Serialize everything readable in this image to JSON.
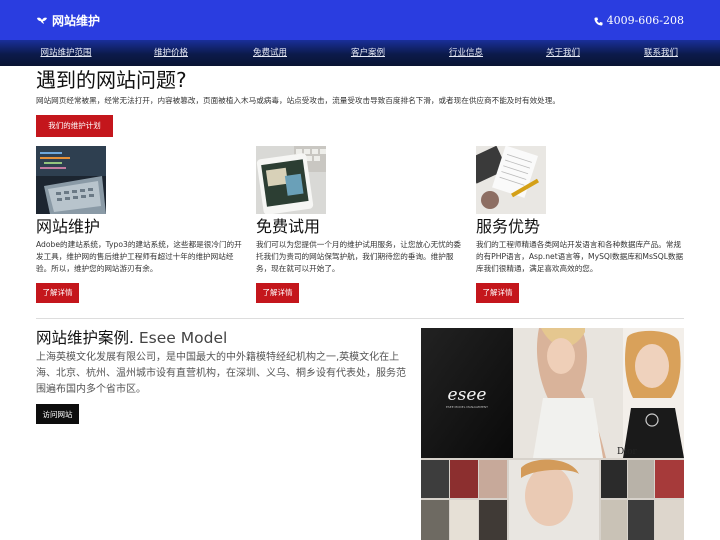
{
  "header": {
    "logo_text": "网站维护",
    "phone": "4009-606-208",
    "brand_color": "#2a3de0"
  },
  "nav": {
    "items": [
      {
        "label": "网站维护范围"
      },
      {
        "label": "维护价格"
      },
      {
        "label": "免费试用"
      },
      {
        "label": "客户案例"
      },
      {
        "label": "行业信息"
      },
      {
        "label": "关于我们"
      },
      {
        "label": "联系我们"
      }
    ]
  },
  "hero": {
    "title": "遇到的网站问题?",
    "description": "网站网页经常被黑，经常无法打开，内容被篡改，页面被植入木马或病毒，站点受攻击，流量受攻击导致百度排名下滑，或者现在供应商不能及时有效处理。",
    "button_label": "我们的维护计划",
    "accent_color": "#c4161c"
  },
  "features": [
    {
      "title": "网站维护",
      "text": "Adobe的建站系统，Typo3的建站系统，这些都是很冷门的开发工具，维护网的售后维护工程师有超过十年的维护网站经验。所以，维护您的网站游刃有余。",
      "button_label": "了解详情",
      "image_icon": "laptop-code-photo"
    },
    {
      "title": "免费试用",
      "text": "我们可以为您提供一个月的维护试用服务，让您放心无忧的委托我们为贵司的网站保驾护航，我们期待您的垂询。维护服务，现在就可以开始了。",
      "button_label": "了解详情",
      "image_icon": "tablet-keyboard-photo"
    },
    {
      "title": "服务优势",
      "text": "我们的工程师精通各类网站开发语言和各种数据库产品。常规的有PHP语言，Asp.net语言等，MySQl数据库和MsSQL数据库我们很精通，满足喜欢高效的您。",
      "button_label": "了解详情",
      "image_icon": "desk-notebook-photo"
    }
  ],
  "case_study": {
    "title_cn": "网站维护案例.",
    "title_en": "Esee Model",
    "text": "上海英模文化发展有限公司，是中国最大的中外籍模特经纪机构之一,英模文化在上海、北京、杭州、温州城市设有直营机构，在深圳、义乌、桐乡设有代表处，服务范围遍布国内多个省市区。",
    "button_label": "访问网站",
    "image_logo": "esee",
    "image_logo_sub": "ESEE MODEL MANAGEMENT",
    "image_brand": "Dior"
  }
}
